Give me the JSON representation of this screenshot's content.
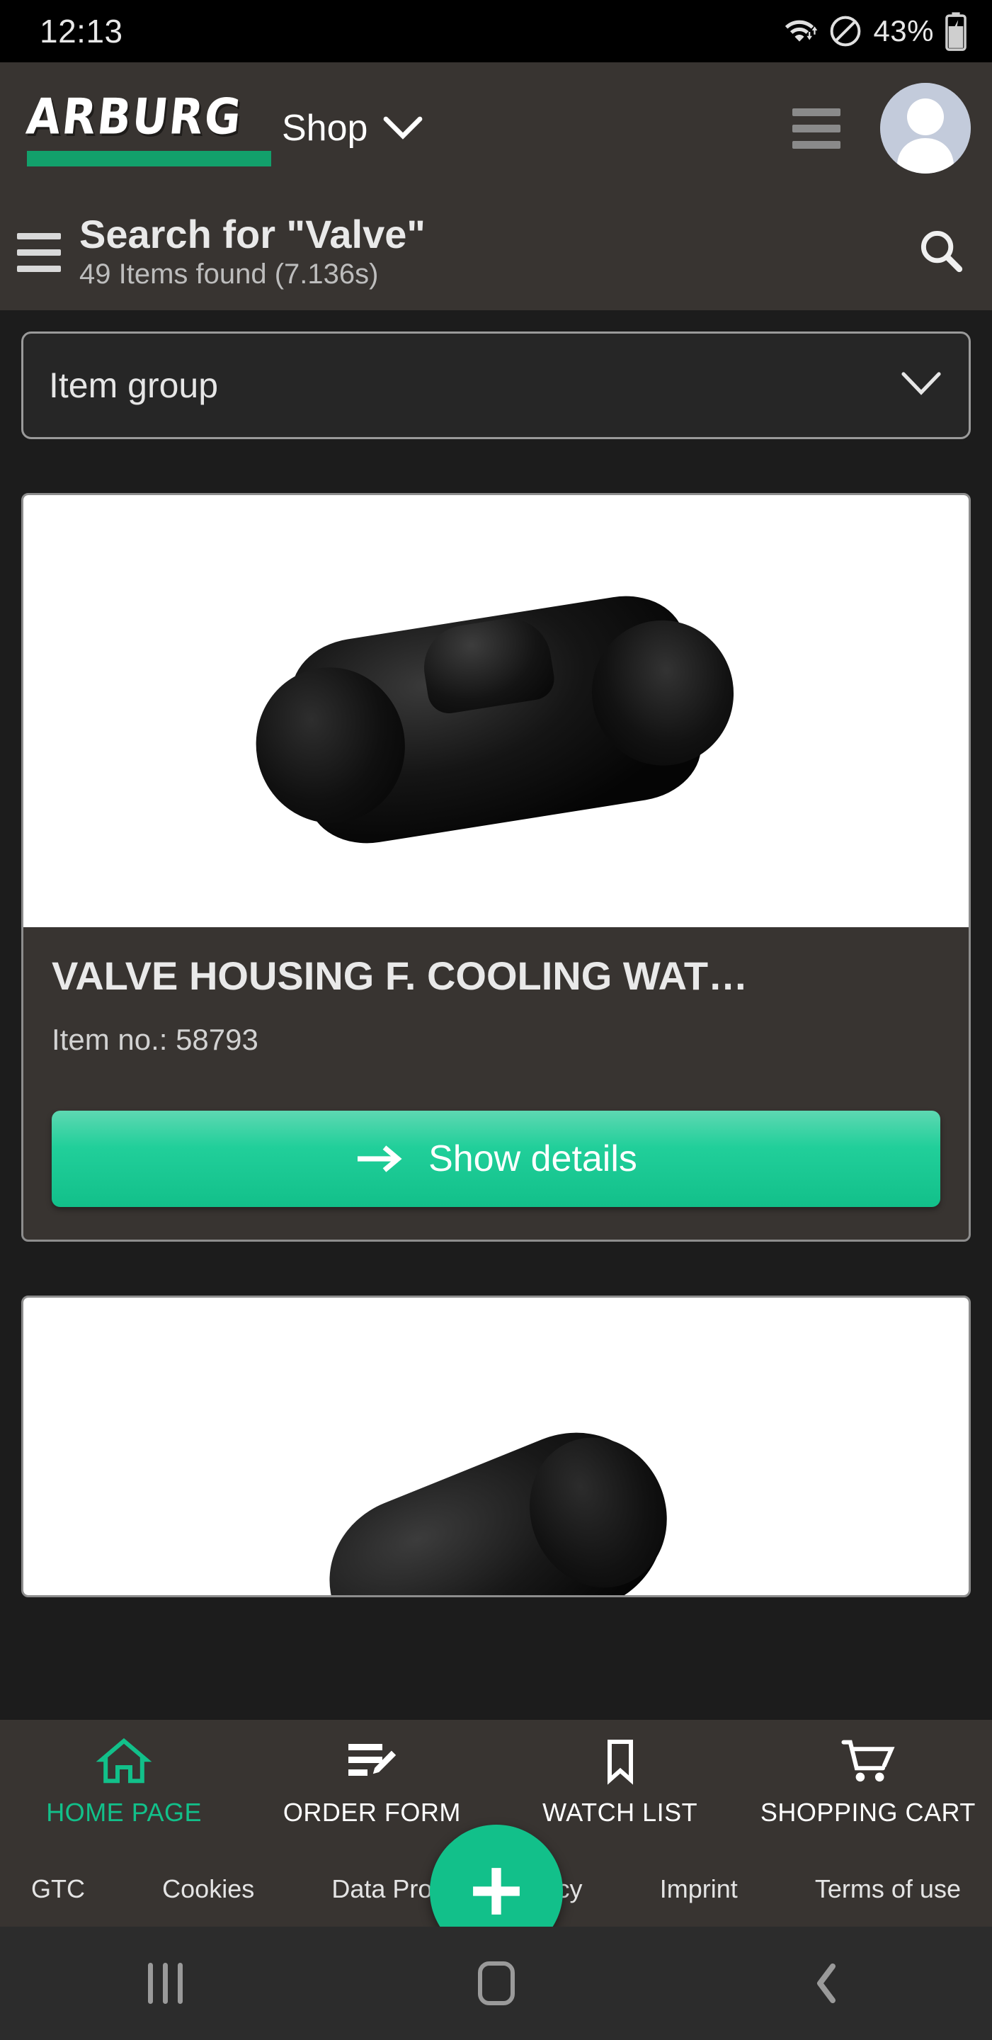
{
  "statusbar": {
    "time": "12:13",
    "battery_percent": "43%",
    "icons": [
      "wifi-icon",
      "do-not-disturb-icon",
      "battery-charging-icon"
    ]
  },
  "header": {
    "logo_text": "ARBURG",
    "shop_label": "Shop",
    "shop_chevron": "chevron-down-icon",
    "menu_icon": "hamburger-menu-icon",
    "avatar_icon": "user-avatar-icon",
    "search_title": "Search for \"Valve\"",
    "search_subtitle": "49 Items found (7.136s)",
    "search_icon": "search-icon",
    "drawer_icon": "hamburger-menu-icon"
  },
  "filters": {
    "item_group_label": "Item group",
    "item_group_chevron": "chevron-down-icon"
  },
  "products": [
    {
      "title": "VALVE HOUSING F. COOLING WAT…",
      "item_no_label": "Item no.: 58793",
      "button_label": "Show details",
      "button_icon": "arrow-right-icon",
      "image_alt": "valve-housing-product-image"
    },
    {
      "image_alt": "valve-component-product-image"
    }
  ],
  "fab": {
    "icon": "plus-icon"
  },
  "bottom_nav": [
    {
      "label": "HOME PAGE",
      "icon": "home-icon",
      "active": true
    },
    {
      "label": "ORDER FORM",
      "icon": "order-form-icon",
      "active": false
    },
    {
      "label": "WATCH LIST",
      "icon": "bookmark-icon",
      "active": false
    },
    {
      "label": "SHOPPING CART",
      "icon": "shopping-cart-icon",
      "active": false
    }
  ],
  "footer_links": [
    {
      "label": "GTC"
    },
    {
      "label": "Cookies"
    },
    {
      "label": "Data Protection Policy"
    },
    {
      "label": "Imprint"
    },
    {
      "label": "Terms of use"
    }
  ],
  "android_nav": {
    "recents_icon": "recents-icon",
    "home_icon": "home-square-icon",
    "back_icon": "back-chevron-icon"
  },
  "colors": {
    "accent_green": "#12c08a",
    "logo_green": "#12a06b",
    "header_bg": "#383431",
    "page_bg": "#1c1c1c"
  }
}
